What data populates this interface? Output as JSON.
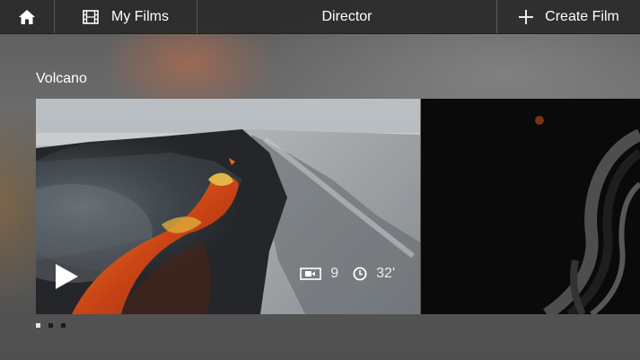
{
  "header": {
    "my_films_label": "My Films",
    "title": "Director",
    "create_label": "Create Film"
  },
  "section": {
    "label": "Volcano"
  },
  "film_card": {
    "clip_count": "9",
    "duration": "32'"
  },
  "pagination": {
    "total": 3,
    "active_index": 0
  },
  "icons": {
    "home": "home-icon",
    "my_films": "film-strip-icon",
    "create": "plus-icon",
    "play": "play-icon",
    "clips": "video-camera-icon",
    "duration": "clock-icon"
  }
}
